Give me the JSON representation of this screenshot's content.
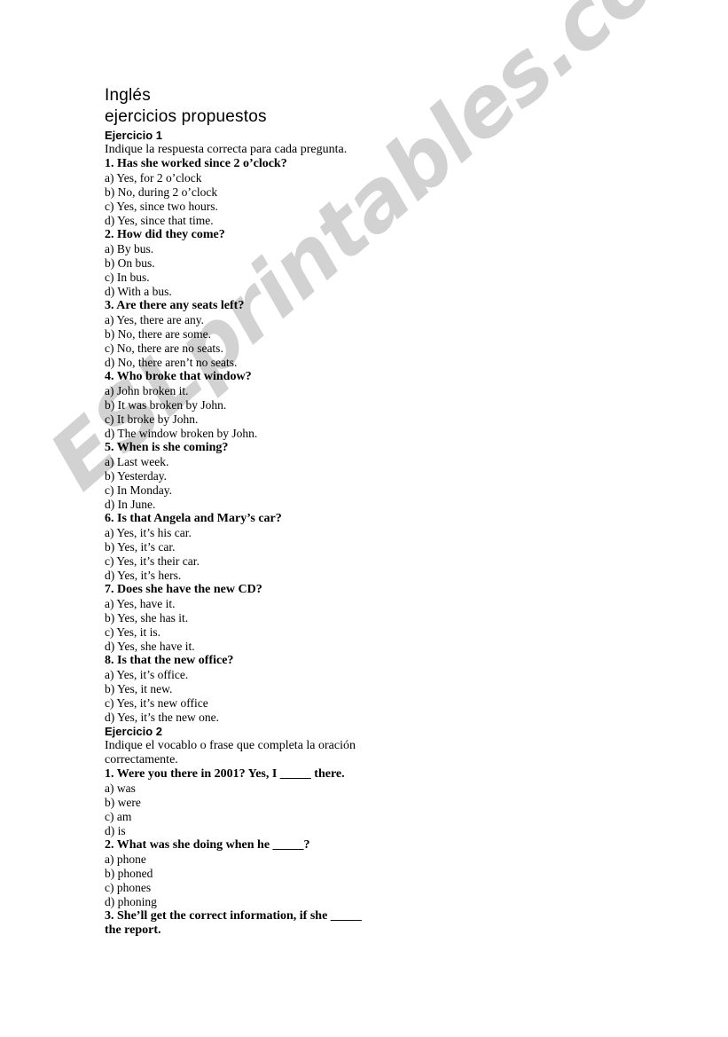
{
  "document": {
    "title": "Inglés",
    "subtitle": "ejercicios propuestos",
    "watermark": "ESLprintables.com",
    "watermark_color": "#d2d2d2",
    "text_color": "#000000",
    "background_color": "#ffffff"
  },
  "exercises": [
    {
      "heading": "Ejercicio 1",
      "instructions": "Indique la respuesta correcta para cada pregunta.",
      "questions": [
        {
          "prompt": "1. Has she worked since 2 o’clock?",
          "options": [
            "a) Yes, for 2 o’clock",
            "b) No, during 2 o’clock",
            "c) Yes, since two hours.",
            "d) Yes, since that time."
          ]
        },
        {
          "prompt": "2. How did they come?",
          "options": [
            "a) By bus.",
            "b) On bus.",
            "c) In bus.",
            "d) With a bus."
          ]
        },
        {
          "prompt": "3. Are there any seats left?",
          "options": [
            "a) Yes, there are any.",
            "b) No, there are some.",
            "c) No, there are no seats.",
            "d) No, there aren’t no seats."
          ]
        },
        {
          "prompt": "4. Who broke that window?",
          "options": [
            "a) John broken it.",
            "b) It was broken by John.",
            "c) It broke by John.",
            "d) The window broken by John."
          ]
        },
        {
          "prompt": "5. When is she coming?",
          "options": [
            "a) Last week.",
            "b) Yesterday.",
            "c) In Monday.",
            "d) In June."
          ]
        },
        {
          "prompt": "6. Is that Angela and Mary’s car?",
          "options": [
            "a) Yes, it’s his car.",
            "b) Yes, it’s car.",
            "c) Yes, it’s their car.",
            "d) Yes, it’s hers."
          ]
        },
        {
          "prompt": "7. Does she have the new CD?",
          "options": [
            "a) Yes, have it.",
            "b) Yes, she has it.",
            "c) Yes, it is.",
            "d) Yes, she have it."
          ]
        },
        {
          "prompt": "8. Is that the new office?",
          "options": [
            "a) Yes, it’s office.",
            "b) Yes, it new.",
            "c) Yes, it’s new office",
            "d) Yes, it’s the new one."
          ]
        }
      ]
    },
    {
      "heading": "Ejercicio 2",
      "instructions": "Indique el vocablo o frase que completa la oración correctamente.",
      "questions": [
        {
          "prompt": "1. Were you there in 2001? Yes, I _____ there.",
          "options": [
            "a) was",
            "b) were",
            "c) am",
            "d) is"
          ]
        },
        {
          "prompt": "2. What was she doing when he _____?",
          "options": [
            "a) phone",
            "b) phoned",
            "c) phones",
            "d) phoning"
          ]
        },
        {
          "prompt": "3. She’ll get the correct information, if she _____ the report.",
          "options": []
        }
      ]
    }
  ]
}
